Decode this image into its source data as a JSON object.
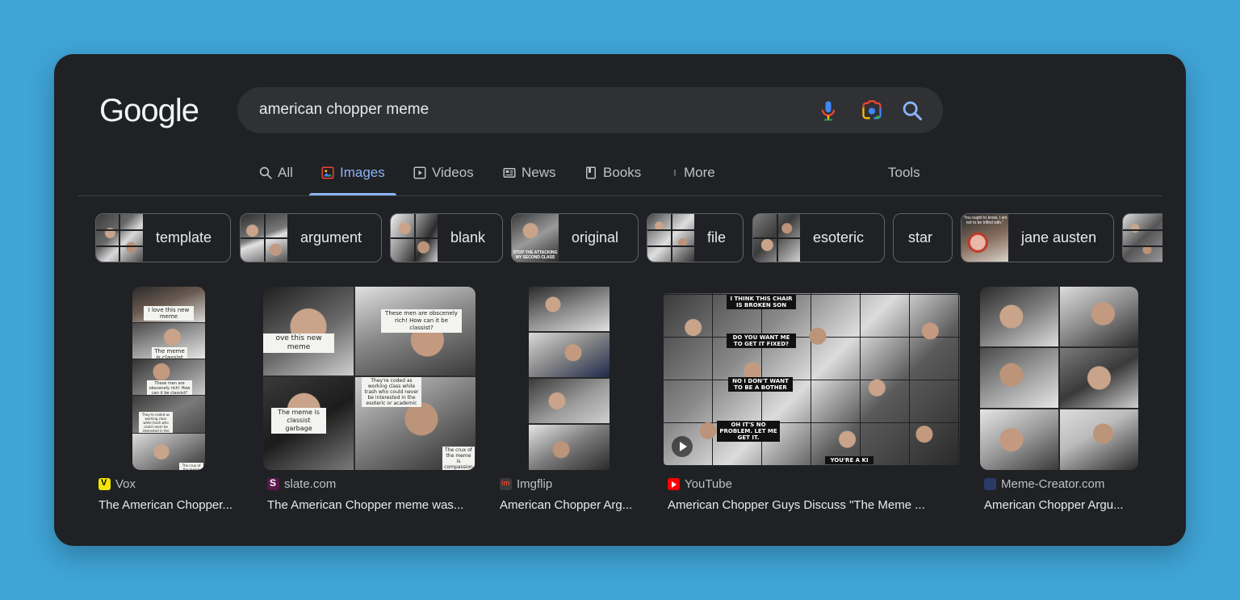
{
  "logo": "Google",
  "search": {
    "query": "american chopper meme",
    "icons": [
      "mic-icon",
      "camera-lens-icon",
      "search-icon"
    ]
  },
  "tabs": [
    {
      "label": "All",
      "icon": "search-icon",
      "active": false
    },
    {
      "label": "Images",
      "icon": "image-icon",
      "active": true
    },
    {
      "label": "Videos",
      "icon": "play-icon",
      "active": false
    },
    {
      "label": "News",
      "icon": "newspaper-icon",
      "active": false
    },
    {
      "label": "Books",
      "icon": "book-icon",
      "active": false
    },
    {
      "label": "More",
      "icon": "more-vert-icon",
      "active": false
    }
  ],
  "tools_label": "Tools",
  "chips": [
    {
      "label": "template"
    },
    {
      "label": "argument"
    },
    {
      "label": "blank"
    },
    {
      "label": "original",
      "thumb_caption": "STOP THE ATTACKING MY SECOND CLASS"
    },
    {
      "label": "file"
    },
    {
      "label": "esoteric"
    },
    {
      "label": "star"
    },
    {
      "label": "jane austen",
      "thumb_caption": "\"You ought to know, I am not to be trifled with.\""
    }
  ],
  "results": [
    {
      "source": "Vox",
      "title": "The American Chopper...",
      "captions": [
        "I love this new meme",
        "The meme is classist garbage",
        "These men are obscenely rich! How can it be classist?",
        "They're coded as working class while trash who could never be interested in the esoteric or academic",
        "The crux of the meme"
      ]
    },
    {
      "source": "slate.com",
      "title": "The American Chopper meme was...",
      "captions": [
        "ove this new meme",
        "These men are obscenely rich! How can it be classist?",
        "They're coded as working class while trash who could never be interested in the esoteric or academic",
        "The meme is classist garbage",
        "The crux of the meme is compassion and"
      ]
    },
    {
      "source": "Imgflip",
      "title": "American Chopper Arg..."
    },
    {
      "source": "YouTube",
      "title": "American Chopper Guys Discuss \"The Meme ...",
      "captions": [
        "I THINK THIS CHAIR IS BROKEN SON",
        "DO YOU WANT ME TO GET IT FIXED?",
        "NO I DON'T WANT TO BE A BOTHER",
        "OH IT'S NO PROBLEM. LET ME GET IT.",
        "YOU'RE A KI"
      ]
    },
    {
      "source": "Meme-Creator.com",
      "title": "American Chopper Argu..."
    }
  ],
  "colors": {
    "background": "#3fa4d6",
    "window": "#202124",
    "accent": "#8ab4f8",
    "text": "#e8eaed",
    "muted": "#bdc1c6"
  }
}
